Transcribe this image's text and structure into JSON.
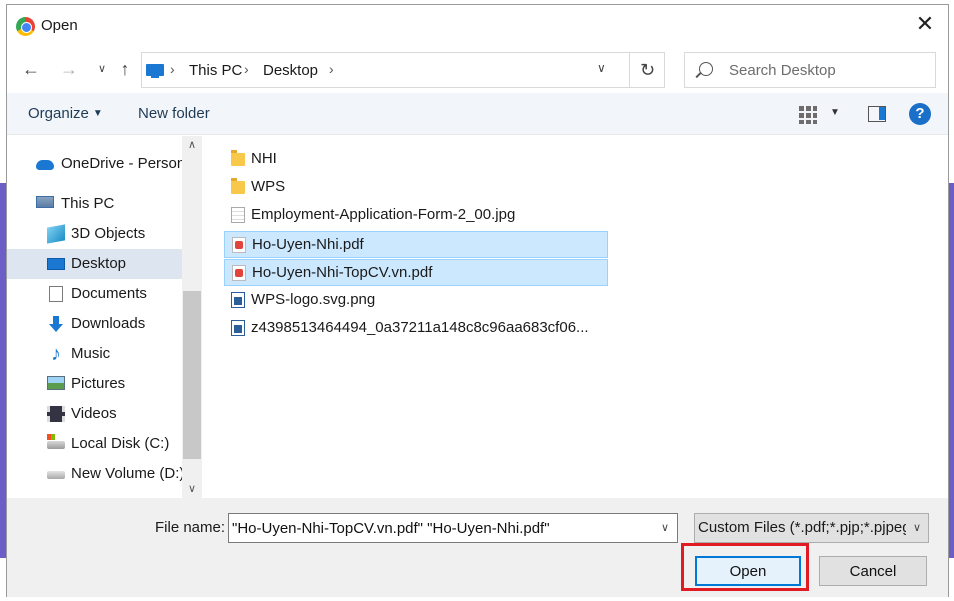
{
  "window": {
    "title": "Open"
  },
  "address": {
    "crumbs": [
      "This PC",
      "Desktop"
    ]
  },
  "search": {
    "placeholder": "Search Desktop"
  },
  "toolbar": {
    "organize": "Organize",
    "new_folder": "New folder",
    "help": "?"
  },
  "sidebar": {
    "items": [
      {
        "label": "OneDrive - Personal",
        "icon": "onedrive-icon"
      },
      {
        "label": "This PC",
        "icon": "pc-icon"
      },
      {
        "label": "3D Objects",
        "icon": "cube-icon"
      },
      {
        "label": "Desktop",
        "icon": "desktop-icon",
        "selected": true
      },
      {
        "label": "Documents",
        "icon": "document-icon"
      },
      {
        "label": "Downloads",
        "icon": "download-icon"
      },
      {
        "label": "Music",
        "icon": "music-icon"
      },
      {
        "label": "Pictures",
        "icon": "pictures-icon"
      },
      {
        "label": "Videos",
        "icon": "video-icon"
      },
      {
        "label": "Local Disk (C:)",
        "icon": "local-disk-icon"
      },
      {
        "label": "New Volume (D:)",
        "icon": "drive-icon"
      }
    ]
  },
  "files": [
    {
      "name": "NHI",
      "icon": "folder-icon"
    },
    {
      "name": "WPS",
      "icon": "folder-icon"
    },
    {
      "name": "Employment-Application-Form-2_00.jpg",
      "icon": "jpg-file-icon"
    },
    {
      "name": "Ho-Uyen-Nhi.pdf",
      "icon": "pdf-file-icon",
      "selected": true
    },
    {
      "name": "Ho-Uyen-Nhi-TopCV.vn.pdf",
      "icon": "pdf-file-icon",
      "selected": true
    },
    {
      "name": "WPS-logo.svg.png",
      "icon": "png-file-icon"
    },
    {
      "name": "z4398513464494_0a37211a148c8c96aa683cf06...",
      "icon": "png-file-icon"
    }
  ],
  "footer": {
    "file_name_label": "File name:",
    "file_name_value": "\"Ho-Uyen-Nhi-TopCV.vn.pdf\" \"Ho-Uyen-Nhi.pdf\"",
    "file_type": "Custom Files (*.pdf;*.pjp;*.pjpeg",
    "open_label": "Open",
    "cancel_label": "Cancel"
  },
  "colors": {
    "accent": "#0078d7",
    "selection": "#cce8ff",
    "highlight": "#e01b24",
    "backdrop": "#6b5fc7"
  }
}
